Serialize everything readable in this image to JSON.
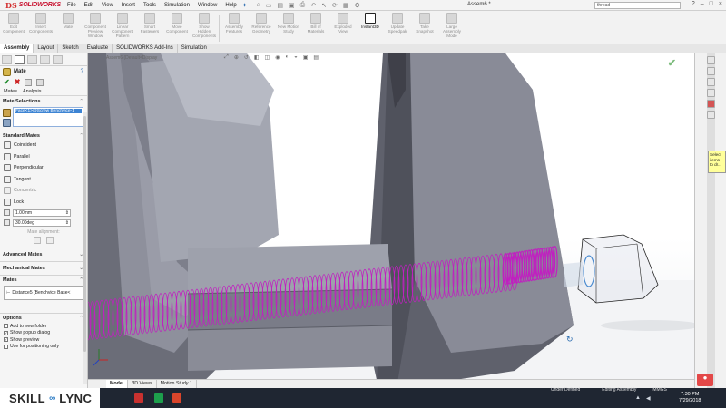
{
  "app": {
    "logo_ds": "DS",
    "logo_name": "SOLIDWORKS",
    "menu": [
      "File",
      "Edit",
      "View",
      "Insert",
      "Tools",
      "Simulation",
      "Window",
      "Help"
    ],
    "document_title": "Assem6 *",
    "search_value": "thread",
    "window_controls": [
      "?",
      "–",
      "□",
      "×"
    ]
  },
  "command_manager": {
    "commands": [
      {
        "label": "Edit Component",
        "icon": "edit-component-icon"
      },
      {
        "label": "Insert Components",
        "icon": "insert-components-icon"
      },
      {
        "label": "Mate",
        "icon": "mate-icon"
      },
      {
        "label": "Component Preview Window",
        "icon": "component-preview-icon"
      },
      {
        "label": "Linear Component Pattern",
        "icon": "linear-pattern-icon"
      },
      {
        "label": "Smart Fasteners",
        "icon": "smart-fasteners-icon"
      },
      {
        "label": "Move Component",
        "icon": "move-component-icon"
      },
      {
        "label": "Show Hidden Components",
        "icon": "show-hidden-icon"
      },
      {
        "label": "Assembly Features",
        "icon": "assembly-features-icon"
      },
      {
        "label": "Reference Geometry",
        "icon": "reference-geometry-icon"
      },
      {
        "label": "New Motion Study",
        "icon": "motion-study-icon"
      },
      {
        "label": "Bill of Materials",
        "icon": "bom-icon"
      },
      {
        "label": "Exploded View",
        "icon": "exploded-view-icon"
      },
      {
        "label": "Instant3D",
        "icon": "instant3d-icon"
      },
      {
        "label": "Update Speedpak",
        "icon": "speedpak-icon"
      },
      {
        "label": "Take Snapshot",
        "icon": "snapshot-icon"
      },
      {
        "label": "Large Assembly Mode",
        "icon": "large-assembly-icon"
      }
    ]
  },
  "tabs": [
    "Assembly",
    "Layout",
    "Sketch",
    "Evaluate",
    "SOLIDWORKS Add-Ins",
    "Simulation"
  ],
  "property_manager": {
    "title": "Mate",
    "help": "?",
    "subtabs": [
      "Mates",
      "Analysis"
    ],
    "mate_selections_title": "Mate Selections",
    "selection_entry": "Face<1>@Screw Benchvice-1",
    "standard_mates_title": "Standard Mates",
    "standard_mates": [
      {
        "label": "Coincident",
        "enabled": true
      },
      {
        "label": "Parallel",
        "enabled": true
      },
      {
        "label": "Perpendicular",
        "enabled": true
      },
      {
        "label": "Tangent",
        "enabled": true
      },
      {
        "label": "Concentric",
        "enabled": false
      },
      {
        "label": "Lock",
        "enabled": true
      }
    ],
    "distance_value": "1.00mm",
    "angle_value": "30.00deg",
    "mate_alignment_label": "Mate alignment:",
    "advanced_mates": "Advanced Mates",
    "mechanical_mates": "Mechanical Mates",
    "mates_title": "Mates",
    "mates_entry": "Distance5 (Benchvice Base<",
    "options_title": "Options",
    "options": [
      {
        "label": "Add to new folder",
        "checked": false
      },
      {
        "label": "Show popup dialog",
        "checked": true
      },
      {
        "label": "Show preview",
        "checked": true
      },
      {
        "label": "Use for positioning only",
        "checked": false
      }
    ]
  },
  "viewport": {
    "tree_hint": "Assem6 (Default<Display"
  },
  "task_pane": {
    "tooltip": "Select items to dr..."
  },
  "bottom_tabs": [
    "Model",
    "3D Views",
    "Motion Study 1"
  ],
  "status": {
    "state": "Under Defined",
    "mode": "Editing Assembly",
    "units": "MMGS"
  },
  "taskbar": {
    "brand_left": "SKILL",
    "brand_right": "LYNC",
    "time": "7:30 PM",
    "date": "7/29/2018"
  },
  "colors": {
    "helix": "#c020c0",
    "part_face": "#8a8c97",
    "part_light": "#a8abb6",
    "part_dark": "#5c5e68",
    "selection": "#3d84d3"
  }
}
